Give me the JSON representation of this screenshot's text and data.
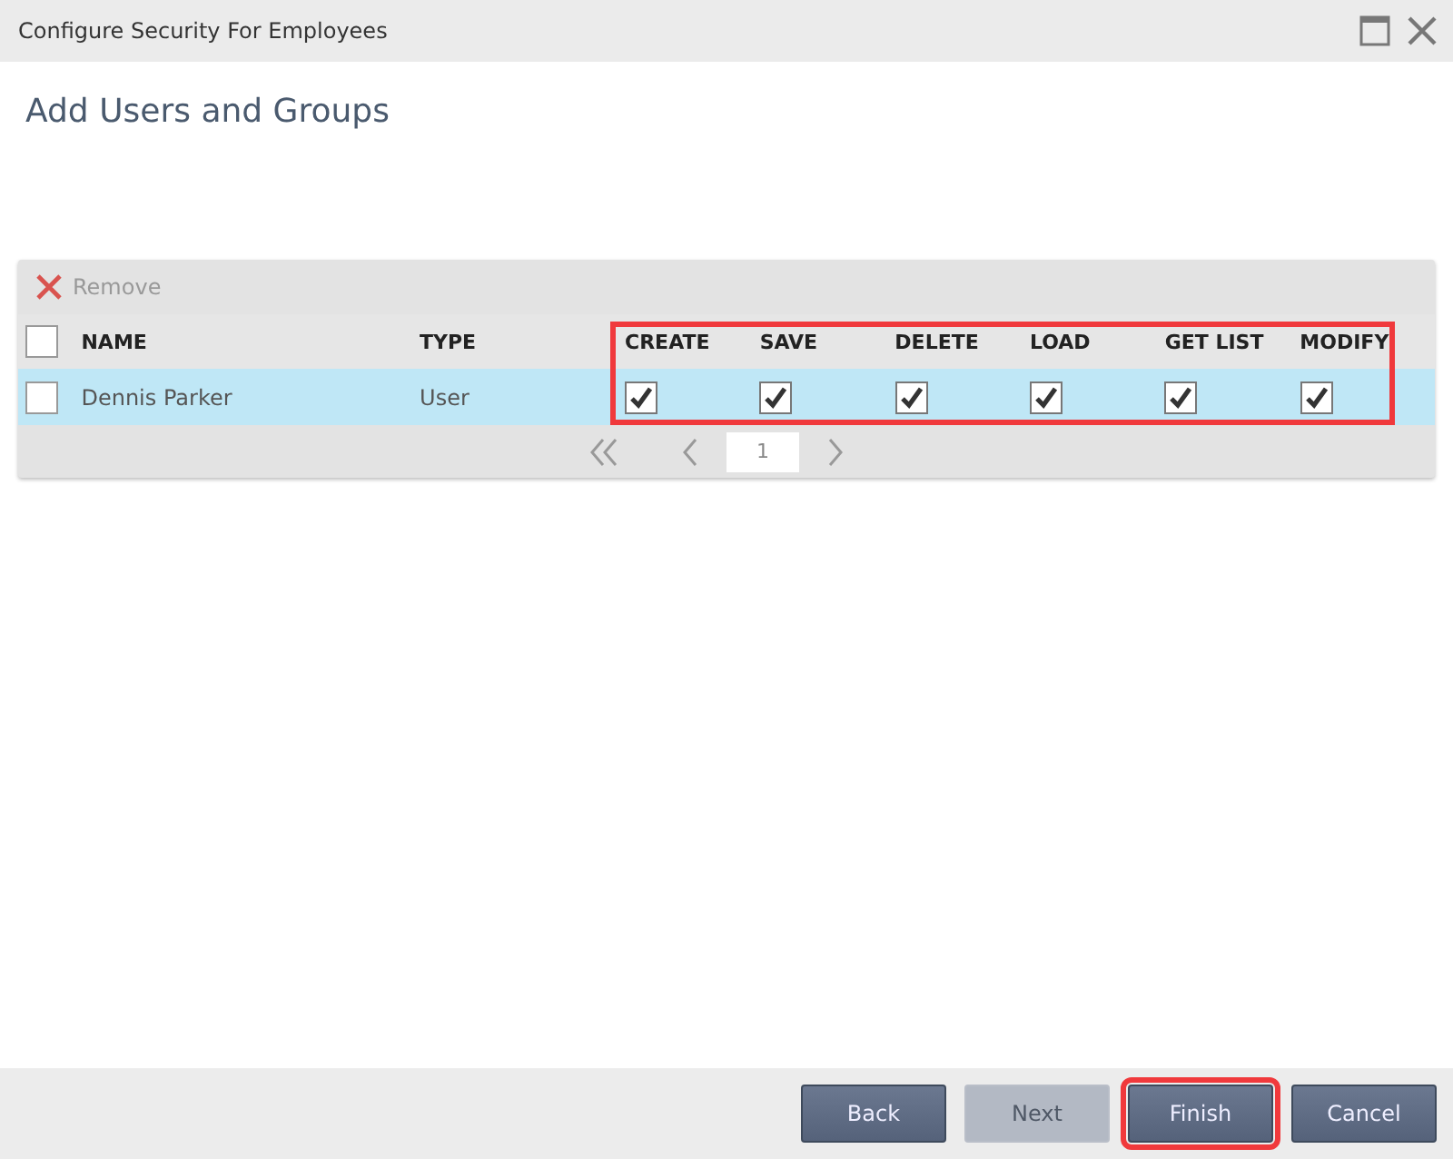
{
  "window": {
    "title": "Configure Security For Employees"
  },
  "heading": "Add Users and Groups",
  "toolbar": {
    "remove": {
      "label": "Remove",
      "disabled": true
    }
  },
  "table": {
    "select_all": {
      "checked": false
    },
    "columns": [
      "NAME",
      "TYPE"
    ],
    "permissions": [
      "CREATE",
      "SAVE",
      "DELETE",
      "LOAD",
      "GET LIST",
      "MODIFY"
    ],
    "permissions_highlighted": true,
    "rows": [
      {
        "selected": true,
        "checked": false,
        "name": "Dennis Parker",
        "type": "User",
        "permissions": [
          true,
          true,
          true,
          true,
          true,
          true
        ]
      }
    ]
  },
  "pager": {
    "page": "1"
  },
  "buttons": [
    {
      "label": "Back",
      "disabled": false,
      "highlighted": false
    },
    {
      "label": "Next",
      "disabled": true,
      "highlighted": false
    },
    {
      "label": "Finish",
      "disabled": false,
      "highlighted": true
    },
    {
      "label": "Cancel",
      "disabled": false,
      "highlighted": false
    }
  ]
}
